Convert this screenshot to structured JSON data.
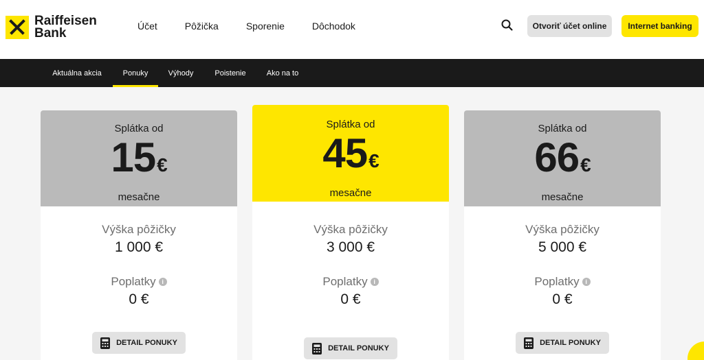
{
  "brand": {
    "line1": "Raiffeisen",
    "line2": "Bank"
  },
  "nav": [
    "Účet",
    "Pôžička",
    "Sporenie",
    "Dôchodok"
  ],
  "header_buttons": {
    "open_account": "Otvoriť účet online",
    "internet_banking": "Internet banking"
  },
  "subnav": [
    "Aktuálna akcia",
    "Ponuky",
    "Výhody",
    "Poistenie",
    "Ako na to"
  ],
  "subnav_active": "Ponuky",
  "cards": [
    {
      "from": "Splátka od",
      "amount": "15",
      "currency": "€",
      "period": "mesačne",
      "loan_label": "Výška pôžičky",
      "loan_value": "1 000 €",
      "fees_label": "Poplatky",
      "fees_value": "0 €",
      "button": "DETAIL PONUKY"
    },
    {
      "from": "Splátka od",
      "amount": "45",
      "currency": "€",
      "period": "mesačne",
      "loan_label": "Výška pôžičky",
      "loan_value": "3 000 €",
      "fees_label": "Poplatky",
      "fees_value": "0 €",
      "button": "DETAIL PONUKY"
    },
    {
      "from": "Splátka od",
      "amount": "66",
      "currency": "€",
      "period": "mesačne",
      "loan_label": "Výška pôžičky",
      "loan_value": "5 000 €",
      "fees_label": "Poplatky",
      "fees_value": "0 €",
      "button": "DETAIL PONUKY"
    }
  ],
  "info_glyph": "i",
  "colors": {
    "brand_yellow": "#fee600",
    "dark": "#1a1a1a",
    "card_head_gray": "#bababa",
    "button_gray": "#e2e2e2"
  },
  "icons": [
    "search-icon",
    "calculator-icon",
    "info-icon",
    "chat-icon"
  ]
}
